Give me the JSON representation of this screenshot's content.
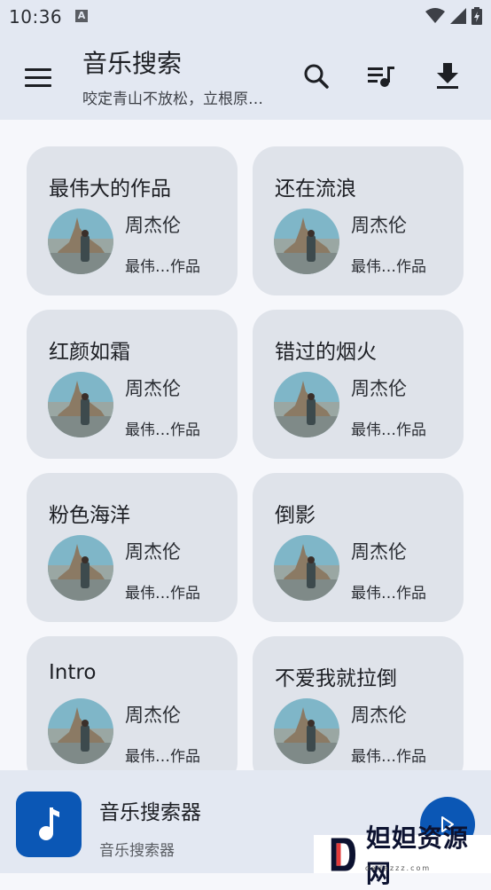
{
  "status_bar": {
    "time": "10:36",
    "a_badge": "A"
  },
  "app_bar": {
    "title": "音乐搜索",
    "subtitle": "咬定青山不放松，立根原…",
    "icons": [
      "menu-icon",
      "search-icon",
      "queue-music-icon",
      "download-icon"
    ]
  },
  "songs": [
    {
      "title": "最伟大的作品",
      "artist": "周杰伦",
      "album": "最伟…作品"
    },
    {
      "title": "还在流浪",
      "artist": "周杰伦",
      "album": "最伟…作品"
    },
    {
      "title": "红颜如霜",
      "artist": "周杰伦",
      "album": "最伟…作品"
    },
    {
      "title": "错过的烟火",
      "artist": "周杰伦",
      "album": "最伟…作品"
    },
    {
      "title": "粉色海洋",
      "artist": "周杰伦",
      "album": "最伟…作品"
    },
    {
      "title": "倒影",
      "artist": "周杰伦",
      "album": "最伟…作品"
    },
    {
      "title": "Intro",
      "artist": "周杰伦",
      "album": "最伟…作品"
    },
    {
      "title": "不爱我就拉倒",
      "artist": "周杰伦",
      "album": "最伟…作品"
    }
  ],
  "player": {
    "title": "音乐搜索器",
    "subtitle": "音乐搜索器"
  },
  "watermark": {
    "text": "妲妲资源网",
    "url": "dadazzz.com"
  },
  "colors": {
    "accent": "#0b57b5",
    "app_bar": "#e3e8f2",
    "card": "#dfe3ea",
    "background": "#f6f7fb"
  }
}
